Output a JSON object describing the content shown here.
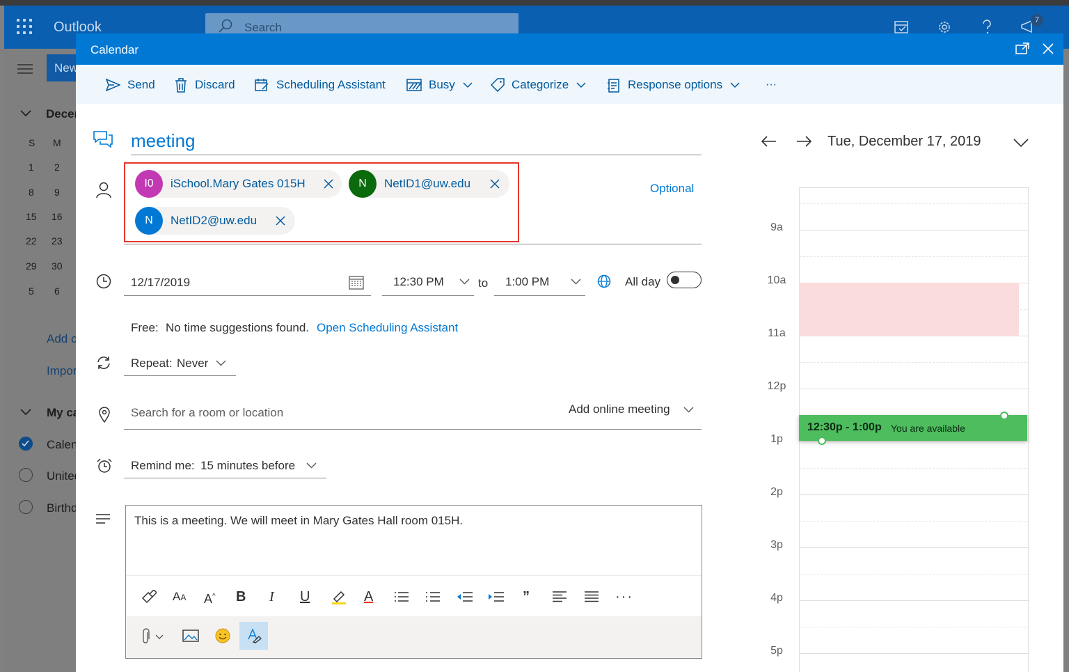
{
  "app": {
    "brand": "Outlook",
    "search_placeholder": "Search",
    "notification_count": "7",
    "new_button": "New"
  },
  "left_pane": {
    "month_label": "December",
    "weekday_headers": [
      "S",
      "M"
    ],
    "weeks": [
      [
        "1",
        "2"
      ],
      [
        "8",
        "9"
      ],
      [
        "15",
        "16"
      ],
      [
        "22",
        "23"
      ],
      [
        "29",
        "30"
      ],
      [
        "5",
        "6"
      ]
    ],
    "add_calendar": "Add calendar",
    "import_calendar": "Import calendar",
    "my_calendars": "My calendars",
    "calendars": [
      {
        "label": "Calendar",
        "checked": true
      },
      {
        "label": "United States holidays",
        "checked": false
      },
      {
        "label": "Birthdays",
        "checked": false
      }
    ]
  },
  "dialog": {
    "title": "Calendar",
    "toolbar": {
      "send": "Send",
      "discard": "Discard",
      "scheduling_assistant": "Scheduling Assistant",
      "show_as": "Busy",
      "categorize": "Categorize",
      "response_options": "Response options",
      "more": "···"
    },
    "event_title": "meeting",
    "attendees": [
      {
        "initials": "I0",
        "name": "iSchool.Mary Gates 015H",
        "color": "#c239b3"
      },
      {
        "initials": "N",
        "name": "NetID1@uw.edu",
        "color": "#0b6a0b"
      },
      {
        "initials": "N",
        "name": "NetID2@uw.edu",
        "color": "#0078d4"
      }
    ],
    "optional_label": "Optional",
    "date": "12/17/2019",
    "start_time": "12:30 PM",
    "to_label": "to",
    "end_time": "1:00 PM",
    "all_day_label": "All day",
    "all_day": false,
    "free_label": "Free:",
    "suggestions_text": "No time suggestions found.",
    "open_scheduling_link": "Open Scheduling Assistant",
    "repeat_label": "Repeat:",
    "repeat_value": "Never",
    "location_placeholder": "Search for a room or location",
    "online_meeting": "Add online meeting",
    "remind_label": "Remind me:",
    "remind_value": "15 minutes before",
    "body_text": "This is a meeting.  We will meet in Mary Gates Hall room 015H."
  },
  "day_view": {
    "date_label": "Tue, December 17, 2019",
    "hours": [
      "9a",
      "10a",
      "11a",
      "12p",
      "1p",
      "2p",
      "3p",
      "4p",
      "5p"
    ],
    "busy_block": {
      "start": "10:00",
      "end": "11:00",
      "color": "#fbdcdc"
    },
    "proposed": {
      "time": "12:30p - 1:00p",
      "status": "You are available",
      "color": "#4dbd5e"
    }
  },
  "colors": {
    "accent": "#0078d4",
    "suite_bar": "#0a5fb0",
    "highlight_border": "#e8362a"
  }
}
